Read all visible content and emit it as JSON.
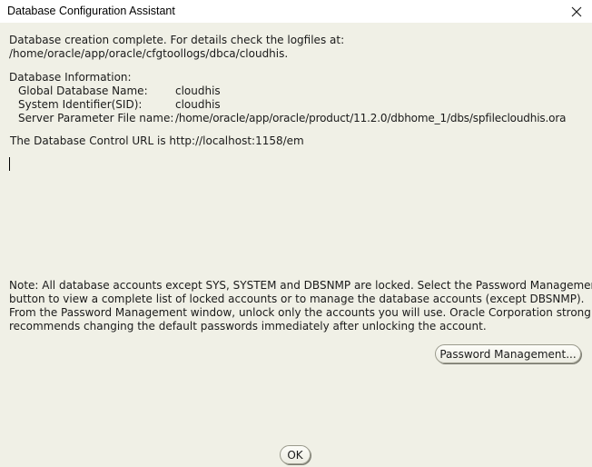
{
  "window": {
    "title": "Database Configuration Assistant",
    "close_icon": "close-icon"
  },
  "message": {
    "creation_line1": "Database creation complete. For details check the logfiles at:",
    "creation_line2": " /home/oracle/app/oracle/cfgtoollogs/dbca/cloudhis.",
    "info_heading": "Database Information:",
    "info": [
      {
        "label": "Global Database Name:",
        "value": "cloudhis"
      },
      {
        "label": "System Identifier(SID):",
        "value": "cloudhis"
      },
      {
        "label": "Server Parameter File name:",
        "value": "/home/oracle/app/oracle/product/11.2.0/dbhome_1/dbs/spfilecloudhis.ora"
      }
    ],
    "control_url_line": "The Database Control URL is http://localhost:1158/em",
    "note_lines": [
      "Note: All database accounts except SYS, SYSTEM and DBSNMP are locked. Select the Password Management",
      "button to view a complete list of locked accounts or to manage the database accounts (except DBSNMP).",
      "From the Password Management window, unlock only the accounts you will use. Oracle Corporation strongly",
      "recommends changing the default passwords immediately after unlocking the account."
    ]
  },
  "buttons": {
    "password_management": "Password Management...",
    "ok": "OK"
  }
}
